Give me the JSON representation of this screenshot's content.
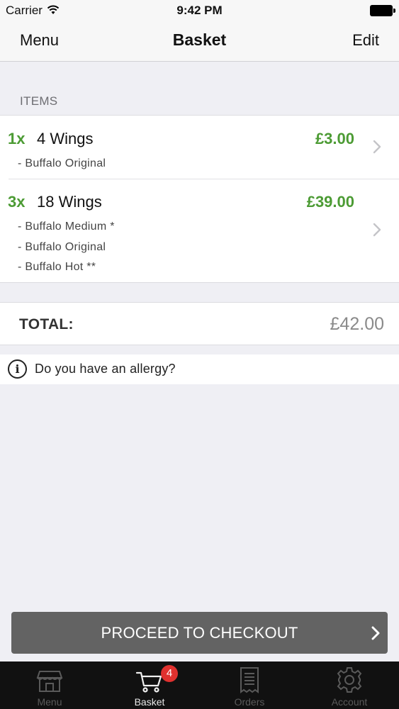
{
  "status_bar": {
    "carrier": "Carrier",
    "time": "9:42 PM",
    "wifi_icon": "wifi-icon",
    "battery_icon": "battery-icon"
  },
  "nav": {
    "left": "Menu",
    "title": "Basket",
    "right": "Edit"
  },
  "section_header": "ITEMS",
  "items": [
    {
      "qty": "1x",
      "name": "4 Wings",
      "price": "£3.00",
      "modifiers": [
        "- Buffalo Original"
      ]
    },
    {
      "qty": "3x",
      "name": "18 Wings",
      "price": "£39.00",
      "modifiers": [
        "- Buffalo Medium *",
        "- Buffalo Original",
        "- Buffalo Hot **"
      ]
    }
  ],
  "total": {
    "label": "TOTAL:",
    "value": "£42.00"
  },
  "allergy": {
    "icon": "info-icon",
    "text": "Do you have an allergy?"
  },
  "checkout": {
    "label": "PROCEED TO CHECKOUT",
    "icon": "chevron-right-icon"
  },
  "tabs": [
    {
      "label": "Menu",
      "icon": "store-icon",
      "active": false
    },
    {
      "label": "Basket",
      "icon": "cart-icon",
      "active": true,
      "badge": "4"
    },
    {
      "label": "Orders",
      "icon": "receipt-icon",
      "active": false
    },
    {
      "label": "Account",
      "icon": "gear-icon",
      "active": false
    }
  ],
  "colors": {
    "accent_green": "#4c9b34",
    "badge_red": "#e0312f",
    "checkout_gray": "#636363",
    "tab_bar": "#111111"
  }
}
